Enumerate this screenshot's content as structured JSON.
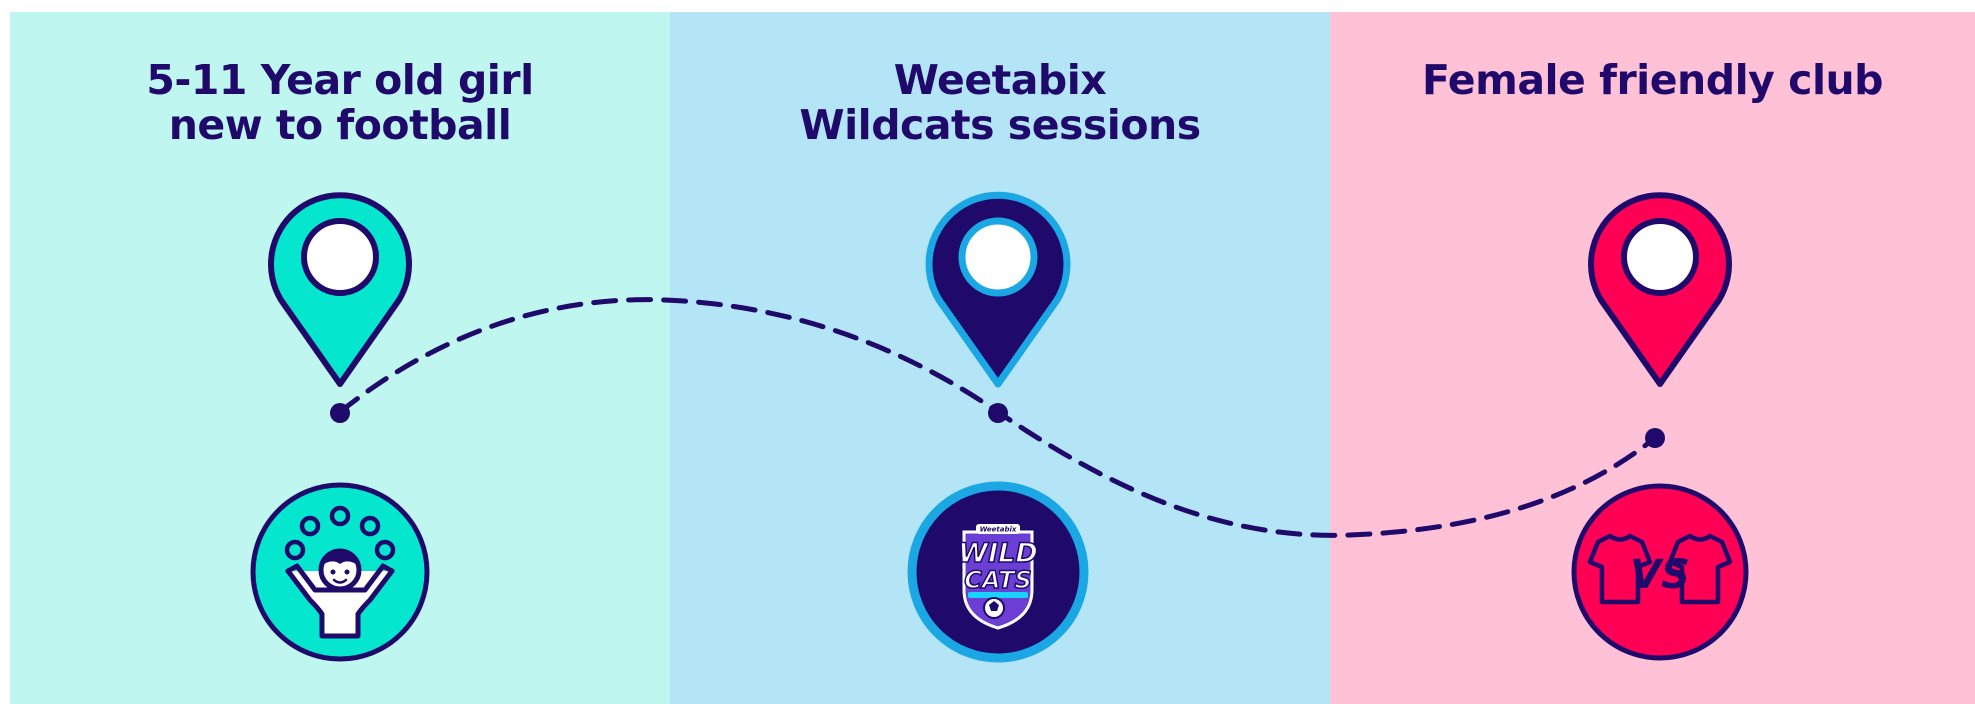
{
  "colors": {
    "navy": "#1f0a6b",
    "teal_bg": "#bff6ef",
    "blue_bg": "#b3e5f7",
    "pink_bg": "#ffc1d6",
    "teal_accent": "#05e6cf",
    "blue_accent": "#1ba7e3",
    "pink_accent": "#ff0054"
  },
  "steps": [
    {
      "title": "5-11 Year old girl\nnew to football",
      "icon": "girl-juggling-balls-icon",
      "pin_icon": "location-pin-teal-icon"
    },
    {
      "title": "Weetabix\nWildcats sessions",
      "icon": "wildcats-badge-icon",
      "pin_icon": "location-pin-navy-icon",
      "badge": {
        "brand": "Weetabix",
        "line1": "WILD",
        "line2": "CATS"
      }
    },
    {
      "title": "Female friendly club",
      "icon": "football-shirts-vs-icon",
      "pin_icon": "location-pin-pink-icon",
      "vs_label": "VS"
    }
  ]
}
